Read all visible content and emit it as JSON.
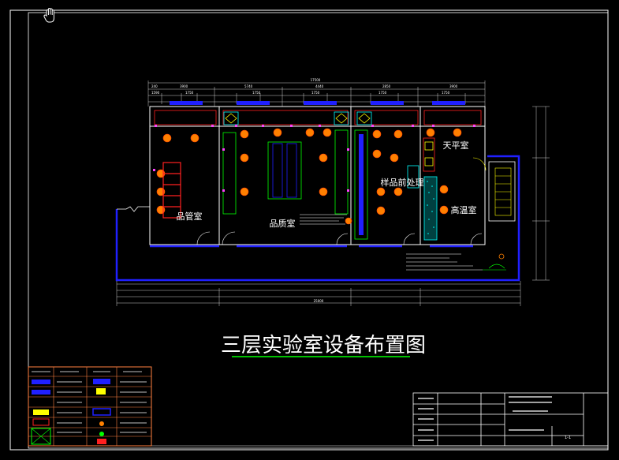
{
  "drawing": {
    "title": "三层实验室设备布置图",
    "rooms": [
      {
        "id": "sample-room",
        "label": "品管室"
      },
      {
        "id": "quality-room",
        "label": "品质室"
      },
      {
        "id": "pretreatment-room",
        "label": "样品前处理"
      },
      {
        "id": "balance-room",
        "label": "天平室"
      },
      {
        "id": "high-temp-room",
        "label": "高温室"
      }
    ],
    "overall_dimension_top": "17500",
    "overall_dimension_bottom": "25000",
    "sheet_number": "1-1",
    "colors": {
      "background": "#000000",
      "wall": "#2020ff",
      "frame": "#ffffff",
      "equipment": "#ff8000",
      "pink": "#ff40ff",
      "green": "#00ff00",
      "cyan": "#00ffff",
      "red": "#ff0000",
      "yellow": "#ffff00",
      "legend_border": "#ff8040"
    },
    "pan_cursor_icon": "hand-icon"
  }
}
